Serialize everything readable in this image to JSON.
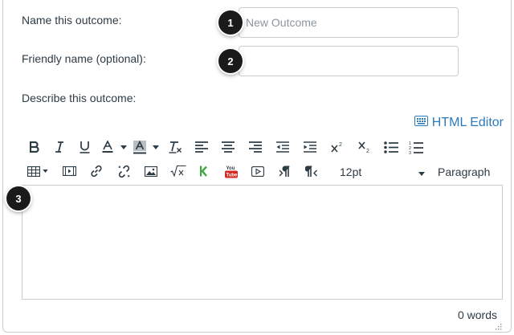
{
  "form": {
    "name_label": "Name this outcome:",
    "name_placeholder": "New Outcome",
    "name_value": "",
    "friendly_label": "Friendly name (optional):",
    "friendly_value": "",
    "describe_label": "Describe this outcome:"
  },
  "callouts": [
    "1",
    "2",
    "3"
  ],
  "editor": {
    "html_editor_label": "HTML Editor",
    "font_size": "12pt",
    "block_format": "Paragraph",
    "word_count": "0 words",
    "toolbar_row1": [
      "bold-icon",
      "italic-icon",
      "underline-icon",
      "text-color-icon",
      "text-color-dropdown-icon",
      "background-color-icon",
      "background-color-dropdown-icon",
      "clear-formatting-icon",
      "align-left-icon",
      "align-center-icon",
      "align-right-icon",
      "outdent-icon",
      "indent-icon",
      "superscript-icon",
      "subscript-icon",
      "bulleted-list-icon",
      "numbered-list-icon"
    ],
    "toolbar_row2": [
      "table-icon",
      "media-icon",
      "link-icon",
      "unlink-icon",
      "image-icon",
      "equation-icon",
      "kaltura-icon",
      "youtube-icon",
      "video-icon",
      "ltr-icon",
      "rtl-icon"
    ]
  },
  "colors": {
    "link_blue": "#2a7abc",
    "text": "#2d3b45",
    "border": "#c7cdd1",
    "callout_bg": "#1a1a1a",
    "kaltura_green": "#3ea83e",
    "youtube_red": "#d7261e"
  }
}
